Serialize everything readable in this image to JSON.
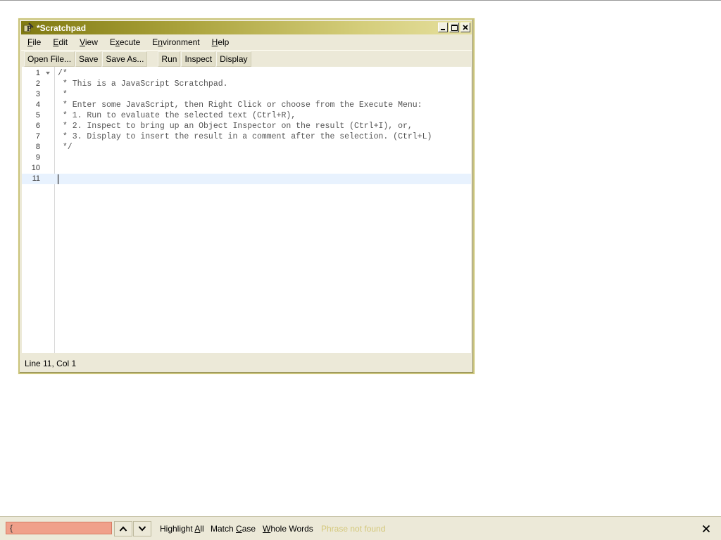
{
  "window": {
    "title": "*Scratchpad",
    "icon": "scratchpad-app-icon",
    "controls": [
      "minimize-icon",
      "maximize-icon",
      "close-icon"
    ]
  },
  "menu": {
    "file": {
      "pre": "",
      "ul": "F",
      "post": "ile"
    },
    "edit": {
      "pre": "",
      "ul": "E",
      "post": "dit"
    },
    "view": {
      "pre": "",
      "ul": "V",
      "post": "iew"
    },
    "execute": {
      "pre": "E",
      "ul": "x",
      "post": "ecute"
    },
    "environment": {
      "pre": "E",
      "ul": "n",
      "post": "vironment"
    },
    "help": {
      "pre": "",
      "ul": "H",
      "post": "elp"
    }
  },
  "toolbar": {
    "open": "Open File...",
    "save": "Save",
    "save_as": "Save As...",
    "run": "Run",
    "inspect": "Inspect",
    "display": "Display"
  },
  "editor": {
    "lines": [
      {
        "num": "1",
        "text": "/*"
      },
      {
        "num": "2",
        "text": " * This is a JavaScript Scratchpad."
      },
      {
        "num": "3",
        "text": " *"
      },
      {
        "num": "4",
        "text": " * Enter some JavaScript, then Right Click or choose from the Execute Menu:"
      },
      {
        "num": "5",
        "text": " * 1. Run to evaluate the selected text (Ctrl+R),"
      },
      {
        "num": "6",
        "text": " * 2. Inspect to bring up an Object Inspector on the result (Ctrl+I), or,"
      },
      {
        "num": "7",
        "text": " * 3. Display to insert the result in a comment after the selection. (Ctrl+L)"
      },
      {
        "num": "8",
        "text": " */"
      },
      {
        "num": "9",
        "text": ""
      },
      {
        "num": "10",
        "text": ""
      },
      {
        "num": "11",
        "text": ""
      }
    ],
    "current_line": "11"
  },
  "status": {
    "position": "Line 11, Col 1"
  },
  "findbar": {
    "query": "{",
    "highlight_all": {
      "pre": "Highlight ",
      "ul": "A",
      "post": "ll"
    },
    "match_case": {
      "pre": "Match ",
      "ul": "C",
      "post": "ase"
    },
    "whole_words": {
      "pre": "",
      "ul": "W",
      "post": "hole Words"
    },
    "status": "Phrase not found"
  },
  "colors": {
    "title_gradient_start": "#807a12",
    "title_gradient_end": "#e6e0a0",
    "chrome": "#ece9d8",
    "find_not_found_bg": "#f0a08a",
    "find_status": "#d4c87b",
    "current_line_bg": "#e8f2fe"
  }
}
